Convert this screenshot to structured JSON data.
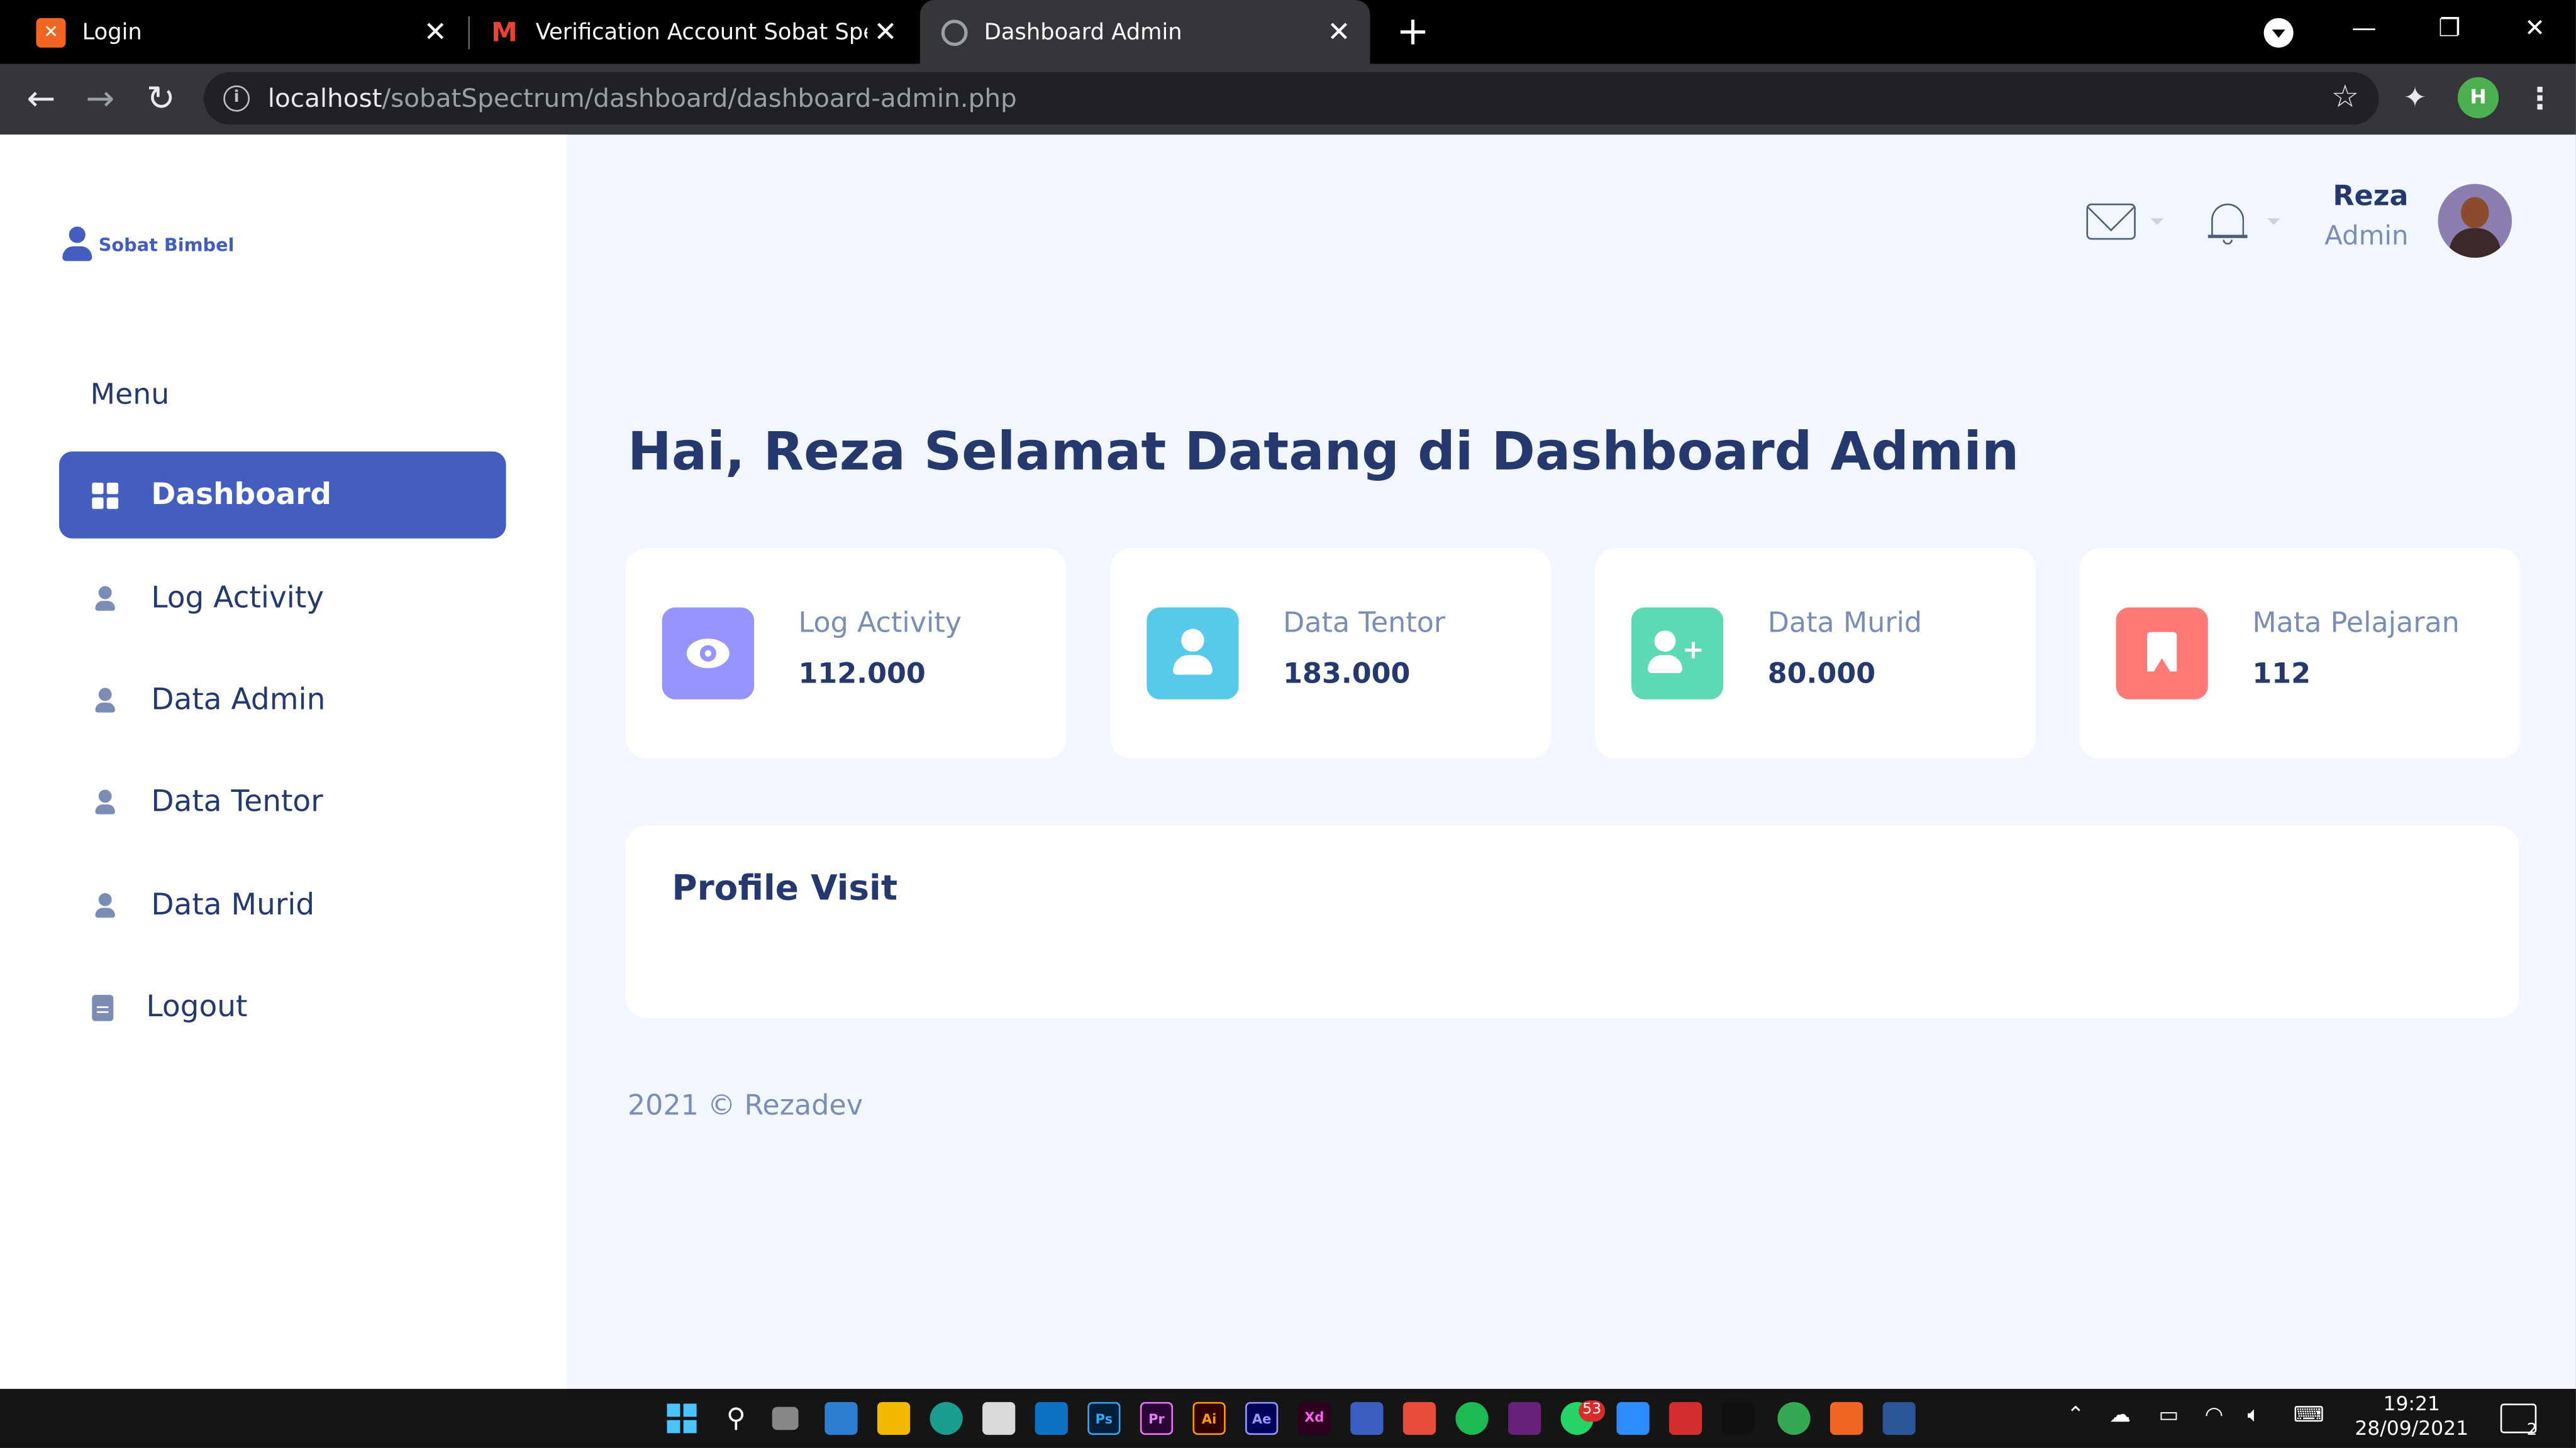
{
  "browser": {
    "tabs": [
      {
        "title": "Login",
        "favicon": "xampp-icon",
        "active": false
      },
      {
        "title": "Verification Account Sobat Spectrum",
        "favicon": "gmail-icon",
        "active": false
      },
      {
        "title": "Dashboard Admin",
        "favicon": "globe-icon",
        "active": true
      }
    ],
    "close_glyph": "✕",
    "new_tab_glyph": "+",
    "url_host": "localhost",
    "url_path": "/sobatSpectrum/dashboard/dashboard-admin.php",
    "profile_initial": "H",
    "window_controls": {
      "minimize": "—",
      "restore": "❐",
      "close": "✕"
    }
  },
  "app": {
    "brand": "Sobat Bimbel",
    "menu_title": "Menu",
    "sidebar": [
      {
        "label": "Dashboard",
        "icon": "grid-icon",
        "active": true
      },
      {
        "label": "Log Activity",
        "icon": "person-icon",
        "active": false
      },
      {
        "label": "Data Admin",
        "icon": "person-icon",
        "active": false
      },
      {
        "label": "Data Tentor",
        "icon": "person-icon",
        "active": false
      },
      {
        "label": "Data Murid",
        "icon": "person-icon",
        "active": false
      },
      {
        "label": "Logout",
        "icon": "document-icon",
        "active": false
      }
    ],
    "user": {
      "name": "Reza",
      "role": "Admin"
    },
    "heading": "Hai, Reza Selamat Datang di Dashboard Admin",
    "stats": [
      {
        "label": "Log Activity",
        "value": "112.000",
        "icon": "eye-icon",
        "color": "#9694ff"
      },
      {
        "label": "Data Tentor",
        "value": "183.000",
        "icon": "user-icon",
        "color": "#57caeb"
      },
      {
        "label": "Data Murid",
        "value": "80.000",
        "icon": "user-plus-icon",
        "color": "#5ddab4"
      },
      {
        "label": "Mata Pelajaran",
        "value": "112",
        "icon": "bookmark-icon",
        "color": "#ff7976"
      }
    ],
    "profile_visit_title": "Profile Visit",
    "footer": "2021 © Rezadev",
    "colors": {
      "primary": "#435ebe",
      "background": "#f2f7ff",
      "heading": "#25396f",
      "muted": "#7c8db5"
    }
  },
  "taskbar": {
    "apps": [
      "Ps",
      "Pr",
      "Ai",
      "Ae",
      "Xd"
    ],
    "badge_count": "53",
    "time": "19:21",
    "date": "28/09/2021",
    "notification_count": "2"
  }
}
